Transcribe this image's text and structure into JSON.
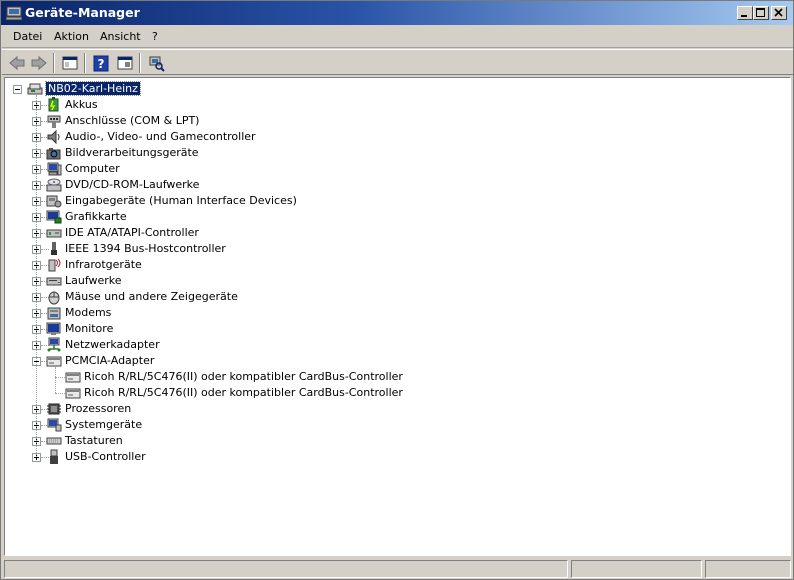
{
  "window": {
    "title": "Geräte-Manager",
    "title_icon": "device-manager-icon"
  },
  "menu": [
    "Datei",
    "Aktion",
    "Ansicht",
    "?"
  ],
  "toolbar": [
    "back-arrow-icon",
    "forward-arrow-icon",
    "console-tree-icon",
    "help-icon",
    "properties-icon",
    "scan-hardware-icon"
  ],
  "tree": {
    "root": "NB02-Karl-Heinz",
    "categories": [
      {
        "label": "Akkus",
        "icon": "battery-icon"
      },
      {
        "label": "Anschlüsse (COM & LPT)",
        "icon": "port-icon"
      },
      {
        "label": "Audio-, Video- und Gamecontroller",
        "icon": "speaker-icon"
      },
      {
        "label": "Bildverarbeitungsgeräte",
        "icon": "camera-icon"
      },
      {
        "label": "Computer",
        "icon": "computer-icon"
      },
      {
        "label": "DVD/CD-ROM-Laufwerke",
        "icon": "cdrom-icon"
      },
      {
        "label": "Eingabegeräte (Human Interface Devices)",
        "icon": "hid-icon"
      },
      {
        "label": "Grafikkarte",
        "icon": "display-adapter-icon"
      },
      {
        "label": "IDE ATA/ATAPI-Controller",
        "icon": "ide-icon"
      },
      {
        "label": "IEEE 1394 Bus-Hostcontroller",
        "icon": "firewire-icon"
      },
      {
        "label": "Infrarotgeräte",
        "icon": "infrared-icon"
      },
      {
        "label": "Laufwerke",
        "icon": "disk-drive-icon"
      },
      {
        "label": "Mäuse und andere Zeigegeräte",
        "icon": "mouse-icon"
      },
      {
        "label": "Modems",
        "icon": "modem-icon"
      },
      {
        "label": "Monitore",
        "icon": "monitor-icon"
      },
      {
        "label": "Netzwerkadapter",
        "icon": "network-icon"
      },
      {
        "label": "PCMCIA-Adapter",
        "icon": "pcmcia-icon",
        "expanded": true,
        "children": [
          {
            "label": "Ricoh R/RL/5C476(II) oder kompatibler CardBus-Controller",
            "icon": "pcmcia-icon"
          },
          {
            "label": "Ricoh R/RL/5C476(II) oder kompatibler CardBus-Controller",
            "icon": "pcmcia-icon"
          }
        ]
      },
      {
        "label": "Prozessoren",
        "icon": "processor-icon"
      },
      {
        "label": "Systemgeräte",
        "icon": "system-devices-icon"
      },
      {
        "label": "Tastaturen",
        "icon": "keyboard-icon"
      },
      {
        "label": "USB-Controller",
        "icon": "usb-icon"
      }
    ]
  }
}
